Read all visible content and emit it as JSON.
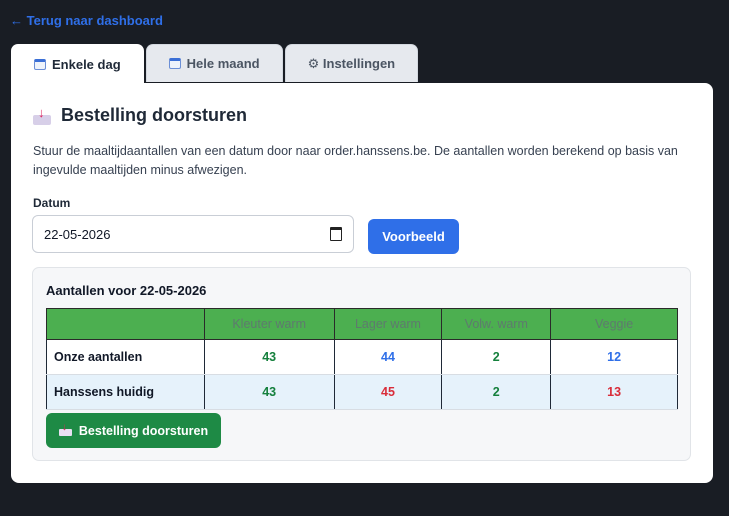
{
  "nav": {
    "back_label": "← Terug naar dashboard"
  },
  "tabs": [
    {
      "label": "Enkele dag",
      "icon": "calendar-icon",
      "active": true
    },
    {
      "label": "Hele maand",
      "icon": "calendar-icon",
      "active": false
    },
    {
      "label": "⚙ Instellingen",
      "icon": "gear-icon",
      "active": false
    }
  ],
  "panel": {
    "title": "Bestelling doorsturen",
    "description": "Stuur de maaltijdaantallen van een datum door naar order.hanssens.be. De aantallen worden berekend op basis van ingevulde maaltijden minus afwezigen.",
    "date_label": "Datum",
    "date_value": "22-05-2026",
    "preview_button": "Voorbeeld"
  },
  "result": {
    "title": "Aantallen voor 22-05-2026",
    "columns": [
      "",
      "Kleuter warm",
      "Lager warm",
      "Volw. warm",
      "Veggie"
    ],
    "rows": [
      {
        "label": "Onze aantallen",
        "values": [
          "43",
          "44",
          "2",
          "12"
        ],
        "colors": [
          "#15803d",
          "#2f6fe8",
          "#15803d",
          "#2f6fe8"
        ]
      },
      {
        "label": "Hanssens huidig",
        "values": [
          "43",
          "45",
          "2",
          "13"
        ],
        "colors": [
          "#15803d",
          "#d92d3a",
          "#15803d",
          "#d92d3a"
        ]
      }
    ],
    "send_button": "Bestelling doorsturen"
  },
  "colors": {
    "accent_blue": "#2f6fe8",
    "send_green": "#1e8a45",
    "header_green": "#4caf50",
    "background": "#191d24"
  }
}
